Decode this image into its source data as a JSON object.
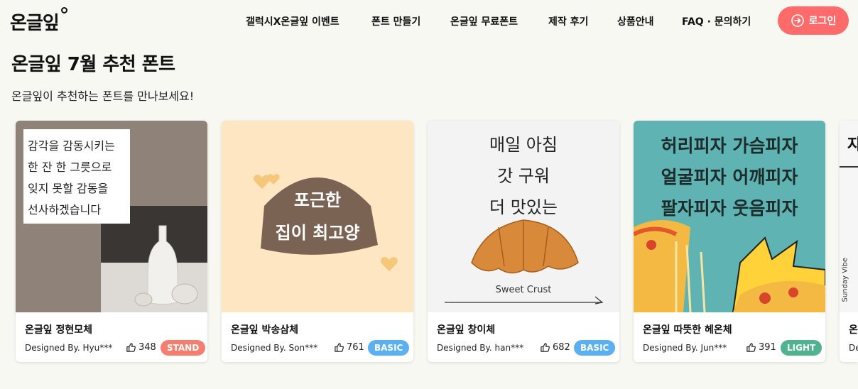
{
  "header": {
    "logo_text": "온글잎",
    "nav": [
      {
        "label": "갤럭시X온글잎 이벤트"
      },
      {
        "label": "폰트 만들기"
      },
      {
        "label": "온글잎 무료폰트"
      },
      {
        "label": "제작 후기"
      },
      {
        "label": "상품안내"
      },
      {
        "label": "FAQ · 문의하기"
      }
    ],
    "login_label": "로그인"
  },
  "section": {
    "title": "온글잎 7월 추천 폰트",
    "subtitle": "온글잎이 추천하는 폰트를 만나보세요!"
  },
  "cards": [
    {
      "name": "온글잎 정현모체",
      "designer": "Designed By. Hyu***",
      "likes": "348",
      "badge": "STAND",
      "badge_color": "#f47f6e",
      "preview_lines": [
        "감각을 감동시키는",
        "한 잔 한 그릇으로",
        "잊지 못할 감동을",
        "선사하겠습니다"
      ]
    },
    {
      "name": "온글잎 박송삼체",
      "designer": "Designed By. Son***",
      "likes": "761",
      "badge": "BASIC",
      "badge_color": "#5ab0f0",
      "preview_lines": [
        "포근한",
        "집이 최고양"
      ]
    },
    {
      "name": "온글잎 창이체",
      "designer": "Designed By. han***",
      "likes": "682",
      "badge": "BASIC",
      "badge_color": "#5ab0f0",
      "preview_lines": [
        "매일 아침",
        "갓 구워",
        "더 맛있는"
      ],
      "caption": "Sweet Crust"
    },
    {
      "name": "온글잎 따뜻한 헤온체",
      "designer": "Designed By. Jun***",
      "likes": "391",
      "badge": "LIGHT",
      "badge_color": "#4fb38f",
      "preview_lines": [
        "허리피자 가슴피자",
        "얼굴피자 어깨피자",
        "팔자피자 웃음피자"
      ]
    },
    {
      "name": "온",
      "designer": "De",
      "preview_lines": [
        "자"
      ],
      "side_text": "Sunday Vibe"
    }
  ],
  "colors": {
    "accent": "#ff6b6b",
    "background": "#f8f8f3"
  }
}
